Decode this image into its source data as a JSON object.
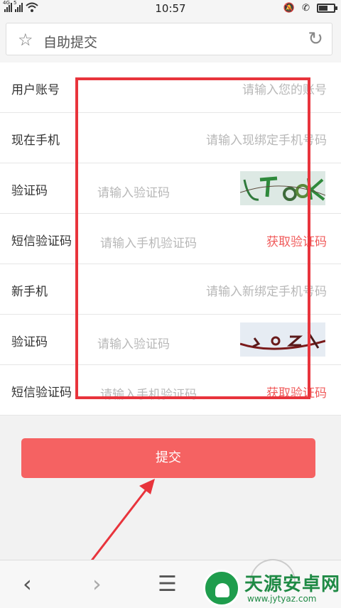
{
  "status_bar": {
    "signal1_label": "4G",
    "signal2_label": "5",
    "time": "10:57",
    "battery_level": 0.6
  },
  "url_bar": {
    "title": "自助提交"
  },
  "form": {
    "rows": [
      {
        "label": "用户账号",
        "placeholder": "请输入您的账号"
      },
      {
        "label": "现在手机",
        "placeholder": "请输入现绑定手机号码"
      },
      {
        "label": "验证码",
        "placeholder": "请输入验证码"
      },
      {
        "label": "短信验证码",
        "placeholder": "请输入手机验证码",
        "action": "获取验证码"
      },
      {
        "label": "新手机",
        "placeholder": "请输入新绑定手机号码"
      },
      {
        "label": "验证码",
        "placeholder": "请输入验证码"
      },
      {
        "label": "短信验证码",
        "placeholder": "请输入手机验证码",
        "action": "获取验证码"
      }
    ]
  },
  "submit_label": "提交",
  "watermark": {
    "title": "天源安卓网",
    "url": "www.jytyaz.com"
  },
  "colors": {
    "accent": "#f56262",
    "highlight": "#e8343c",
    "link": "#f05b5b"
  }
}
